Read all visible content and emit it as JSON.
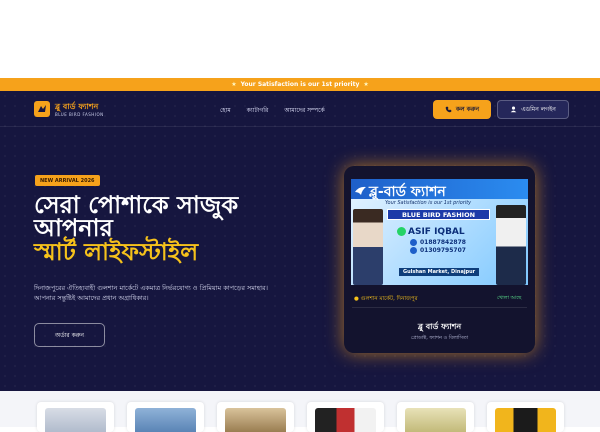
{
  "promo": {
    "text": "Your Satisfaction is our 1st priority"
  },
  "brand": {
    "name": "ব্লু বার্ড ফ্যাশন",
    "subtitle": "BLUE BIRD FASHION"
  },
  "nav": {
    "links": [
      "হোম",
      "ক্যাটাগরি",
      "আমাদের সম্পর্কে"
    ],
    "call_label": "কল করুন",
    "login_label": "এডমিন লগইন"
  },
  "hero": {
    "badge": "NEW ARRIVAL 2026",
    "headline_1": "সেরা পোশাকে সাজুক",
    "headline_2": "আপনার",
    "headline_3": "স্মার্ট লাইফস্টাইল",
    "description": "দিনাজপুরের ঐতিহ্যবাহী গুলশান মার্কেটে একমাত্র নির্ভরযোগ্য ও প্রিমিয়াম কাপড়ের সমাহার। আপনার সন্তুষ্টিই আমাদের প্রধান অগ্রাধিকার।",
    "order_label": "অর্ডার করুন"
  },
  "shop_card": {
    "banner": {
      "title": "ব্লু-বার্ড ফ্যাশন",
      "tagline": "Your Satisfaction is our 1st priority",
      "english_name": "BLUE BIRD FASHION",
      "owner": "ASIF IQBAL",
      "phone_1": "01887842878",
      "phone_2": "01309795707",
      "location": "Gulshan Market, Dinajpur"
    },
    "location": "গুলশান মার্কেট, দিনাজপুর",
    "status": "খোলা আছে",
    "name": "ব্লু বার্ড ফ্যাশন",
    "category": "প্রোডাক্ট, ফ্যাশন ও বিলাসিতা"
  },
  "colors": {
    "accent": "#f6a21b",
    "hero_bg": "#16163f",
    "highlight": "#f6c21b"
  }
}
